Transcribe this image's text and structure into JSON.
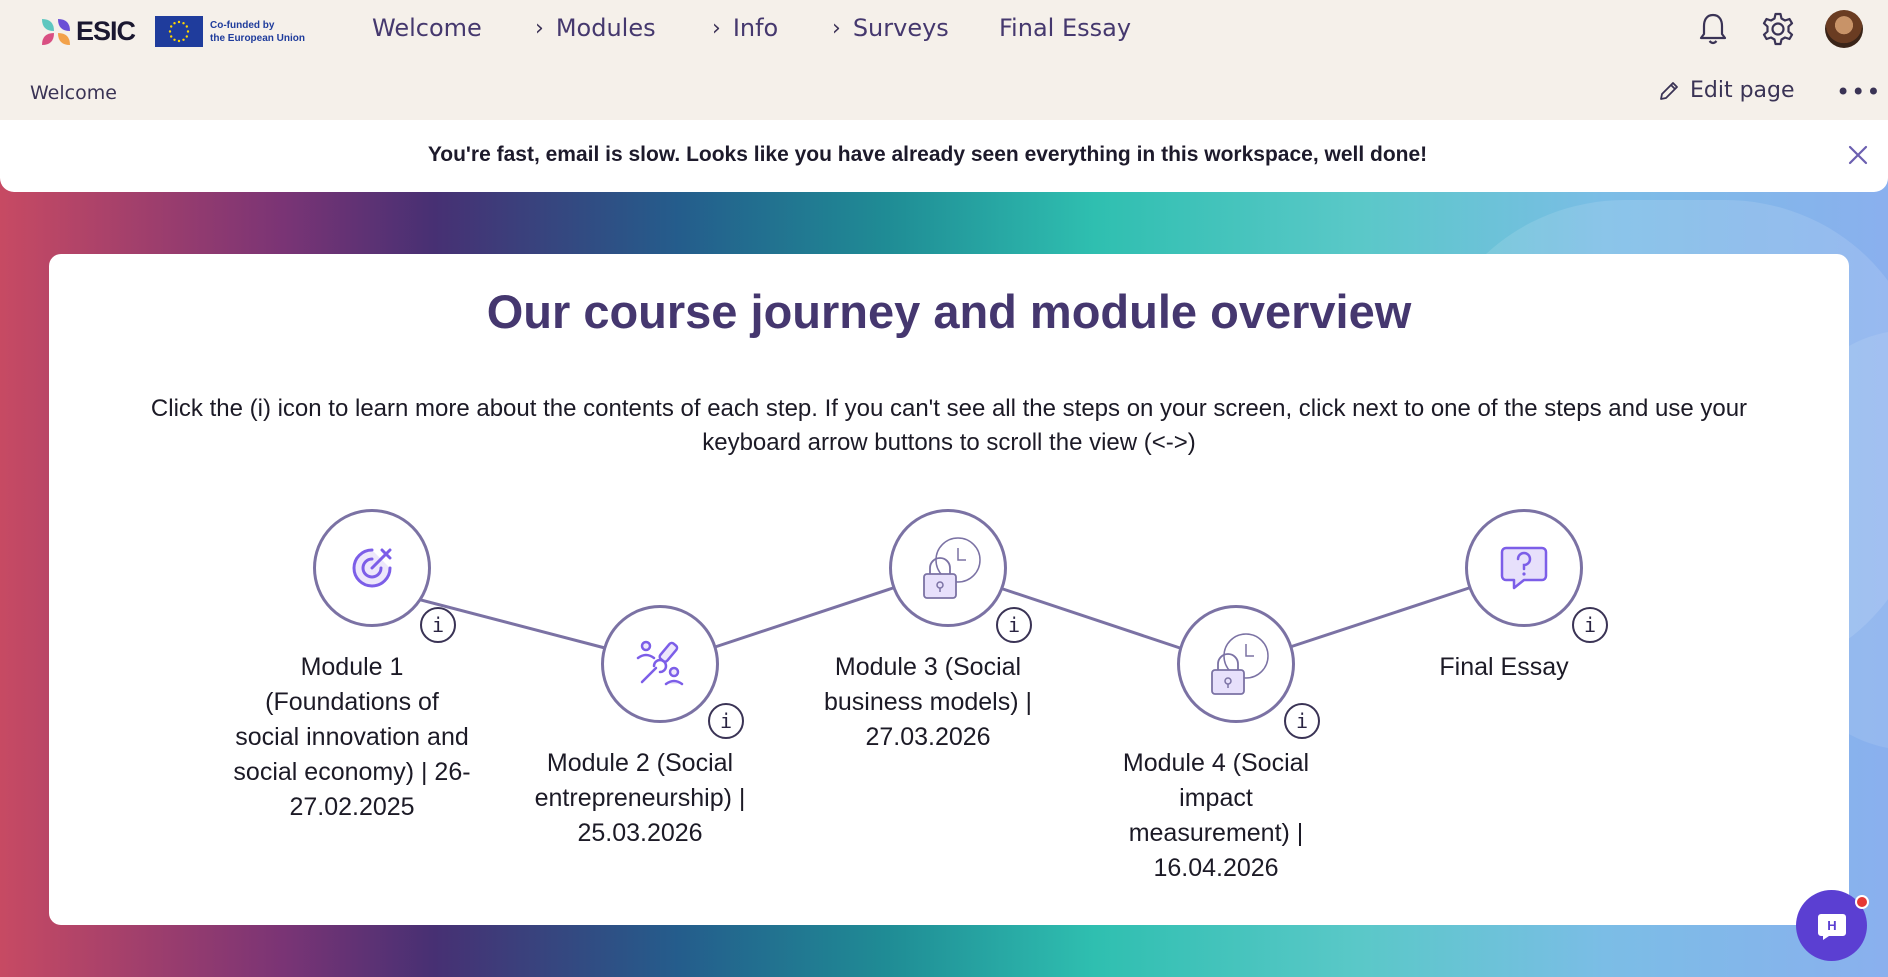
{
  "brand": {
    "logo_text": "ESIC",
    "eu_line1": "Co-funded by",
    "eu_line2": "the European Union"
  },
  "nav": {
    "items": [
      {
        "label": "Welcome",
        "has_chevron": false
      },
      {
        "label": "Modules",
        "has_chevron": true
      },
      {
        "label": "Info",
        "has_chevron": true
      },
      {
        "label": "Surveys",
        "has_chevron": true
      },
      {
        "label": "Final Essay",
        "has_chevron": false
      }
    ],
    "chevron": "›",
    "icons": [
      "bell-icon",
      "gear-icon",
      "avatar"
    ]
  },
  "subnav": {
    "breadcrumb": "Welcome",
    "edit_label": "Edit page",
    "more_label": "•••"
  },
  "banner": {
    "text": "You're fast, email is slow. Looks like you have already seen everything in this workspace, well done!"
  },
  "card": {
    "title": "Our course journey and module overview",
    "description": "Click the (i) icon to learn more about the contents of each step. If you can't see all the steps on your screen, click next to one of the steps and use your keyboard arrow buttons to scroll the view (<->)"
  },
  "steps": [
    {
      "label": "Module 1 (Foundations of social innovation and social economy) | 26-27.02.2025",
      "icon": "target-icon"
    },
    {
      "label": "Module 2 (Social entrepreneurship) | 25.03.2026",
      "icon": "tools-people-icon"
    },
    {
      "label": "Module 3 (Social business models) | 27.03.2026",
      "icon": "lock-clock-icon"
    },
    {
      "label": "Module 4 (Social impact measurement) | 16.04.2026",
      "icon": "lock-clock-icon"
    },
    {
      "label": "Final Essay",
      "icon": "question-bubble-icon"
    }
  ],
  "info_glyph": "i",
  "chat": {
    "glyph": "H"
  },
  "colors": {
    "accent": "#45376f",
    "step_border": "#7b72a4",
    "icon_purple": "#7c5ee8",
    "chat": "#5b3fd2",
    "notification_dot": "#e53935"
  }
}
